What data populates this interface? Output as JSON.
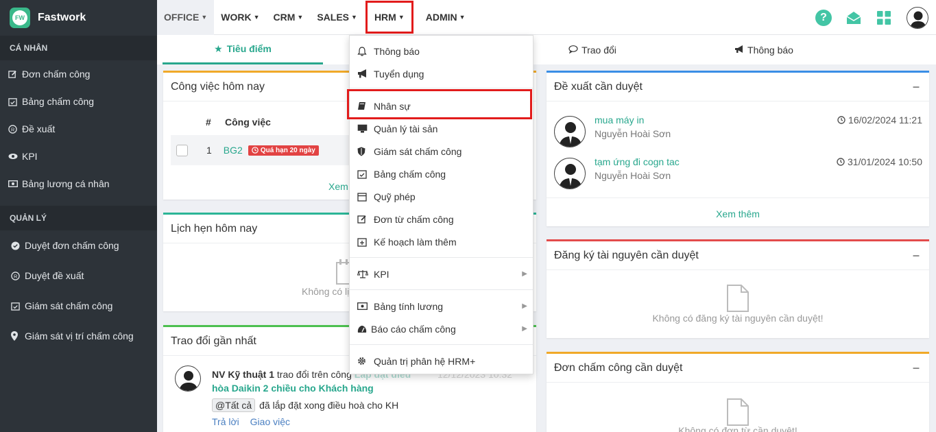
{
  "brand": {
    "name": "Fastwork",
    "logo_text": "FW"
  },
  "sidebar": {
    "personal_heading": "CÁ NHÂN",
    "personal_items": [
      {
        "label": "Đơn chấm công",
        "icon": "edit-icon"
      },
      {
        "label": "Bảng chấm công",
        "icon": "calendar-check-icon"
      },
      {
        "label": "Đề xuất",
        "icon": "registered-icon"
      },
      {
        "label": "KPI",
        "icon": "eye-icon"
      },
      {
        "label": "Bảng lương cá nhân",
        "icon": "money-icon"
      }
    ],
    "manage_heading": "QUẢN LÝ",
    "manage_items": [
      {
        "label": "Duyệt đơn chấm công",
        "icon": "check-circle-icon"
      },
      {
        "label": "Duyệt đề xuất",
        "icon": "registered-icon"
      },
      {
        "label": "Giám sát chấm công",
        "icon": "calendar-check-icon"
      },
      {
        "label": "Giám sát vị trí chấm công",
        "icon": "map-marker-icon"
      }
    ]
  },
  "topnav": {
    "items": [
      "OFFICE",
      "WORK",
      "CRM",
      "SALES",
      "HRM",
      "ADMIN"
    ]
  },
  "tabs": [
    "Tiêu điểm",
    "Trao đổi",
    "Thông báo"
  ],
  "hrm_menu": {
    "items": [
      {
        "label": "Thông báo",
        "icon": "bell-icon"
      },
      {
        "label": "Tuyển dụng",
        "icon": "bullhorn-icon"
      },
      {
        "label": "Nhân sự",
        "icon": "book-icon"
      },
      {
        "label": "Quản lý tài sản",
        "icon": "desktop-icon"
      },
      {
        "label": "Giám sát chấm công",
        "icon": "shield-icon"
      },
      {
        "label": "Bảng chấm công",
        "icon": "calendar-check-icon"
      },
      {
        "label": "Quỹ phép",
        "icon": "calendar-icon"
      },
      {
        "label": "Đơn từ chấm công",
        "icon": "edit-icon"
      },
      {
        "label": "Kế hoạch làm thêm",
        "icon": "calendar-plus-icon"
      },
      {
        "label": "KPI",
        "icon": "balance-scale-icon"
      },
      {
        "label": "Bảng tính lương",
        "icon": "money-icon"
      },
      {
        "label": "Báo cáo chấm công",
        "icon": "dashboard-icon"
      },
      {
        "label": "Quản trị phân hệ HRM+",
        "icon": "gear-icon"
      }
    ]
  },
  "today_work": {
    "title": "Công việc hôm nay",
    "col_index": "#",
    "col_task": "Công việc",
    "row": {
      "index": "1",
      "task": "BG2",
      "badge": "Quá hạn 20 ngày"
    },
    "more": "Xem"
  },
  "appointments": {
    "title": "Lịch hẹn hôm nay",
    "empty": "Không có lị"
  },
  "recent_exchange": {
    "title": "Trao đổi gần nhất",
    "author": "NV Kỹ thuật 1",
    "action": "trao đổi trên công",
    "subject_line1": "Lắp đặt điều",
    "subject_line2": "hòa Daikin 2 chiều cho Khách hàng",
    "time": "12/12/2023 10:32",
    "mention": "@Tất cả",
    "message": "đã lắp đặt xong điều hoà cho KH",
    "reply": "Trả lời",
    "assign": "Giao việc"
  },
  "proposals": {
    "title": "Đề xuất cần duyệt",
    "items": [
      {
        "title": "mua máy in",
        "person": "Nguyễn Hoài Sơn",
        "time": "16/02/2024 11:21"
      },
      {
        "title": "tạm ứng đi cogn tac",
        "person": "Nguyễn Hoài Sơn",
        "time": "31/01/2024 10:50"
      }
    ],
    "more": "Xem thêm"
  },
  "resources": {
    "title": "Đăng ký tài nguyên cần duyệt",
    "empty": "Không có đăng ký tài nguyên cần duyệt!"
  },
  "attendance": {
    "title": "Đơn chấm công cần duyệt",
    "empty": "Không có đơn từ cần duyệt!"
  },
  "colors": {
    "accent": "#28a78d",
    "sidebar": "#2d3339",
    "highlight": "#e21b1b",
    "card_orange": "#f0a928",
    "card_blue": "#3a8ee6",
    "card_red": "#e34b4b",
    "card_green": "#4cbf4f"
  }
}
